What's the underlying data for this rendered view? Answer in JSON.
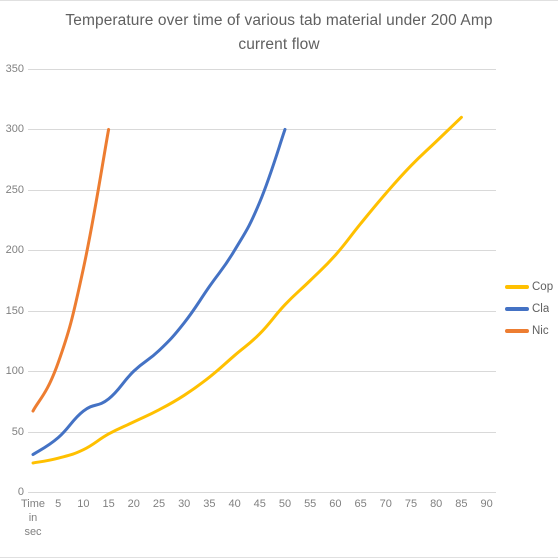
{
  "chart_data": {
    "type": "line",
    "title": "Temperature over time of various tab material under 200 Amp current flow",
    "xlabel": "Time in sec",
    "ylabel": "",
    "ylim": [
      0,
      350
    ],
    "y_ticks": [
      0,
      50,
      100,
      150,
      200,
      250,
      300,
      350
    ],
    "grid": true,
    "legend_position": "right",
    "categories": [
      "Time in sec",
      "5",
      "10",
      "15",
      "20",
      "25",
      "30",
      "35",
      "40",
      "45",
      "50",
      "55",
      "60",
      "65",
      "70",
      "75",
      "80",
      "85",
      "90"
    ],
    "series": [
      {
        "name": "Copper",
        "color": "#FFC000",
        "values": [
          24,
          28,
          35,
          48,
          58,
          68,
          80,
          95,
          113,
          131,
          155,
          175,
          196,
          222,
          247,
          270,
          290,
          310,
          null
        ]
      },
      {
        "name": "Clad",
        "color": "#4472C4",
        "values": [
          31,
          45,
          67,
          77,
          100,
          117,
          140,
          170,
          200,
          240,
          300,
          null,
          null,
          null,
          null,
          null,
          null,
          null,
          null
        ]
      },
      {
        "name": "Nickel",
        "color": "#ED7D31",
        "values": [
          67,
          107,
          185,
          300,
          null,
          null,
          null,
          null,
          null,
          null,
          null,
          null,
          null,
          null,
          null,
          null,
          null,
          null,
          null
        ]
      }
    ]
  },
  "legend": {
    "items": [
      {
        "label": "Cop",
        "color": "#FFC000",
        "name": "legend-item-copper"
      },
      {
        "label": "Cla",
        "color": "#4472C4",
        "name": "legend-item-clad"
      },
      {
        "label": "Nic",
        "color": "#ED7D31",
        "name": "legend-item-nickel"
      }
    ]
  }
}
